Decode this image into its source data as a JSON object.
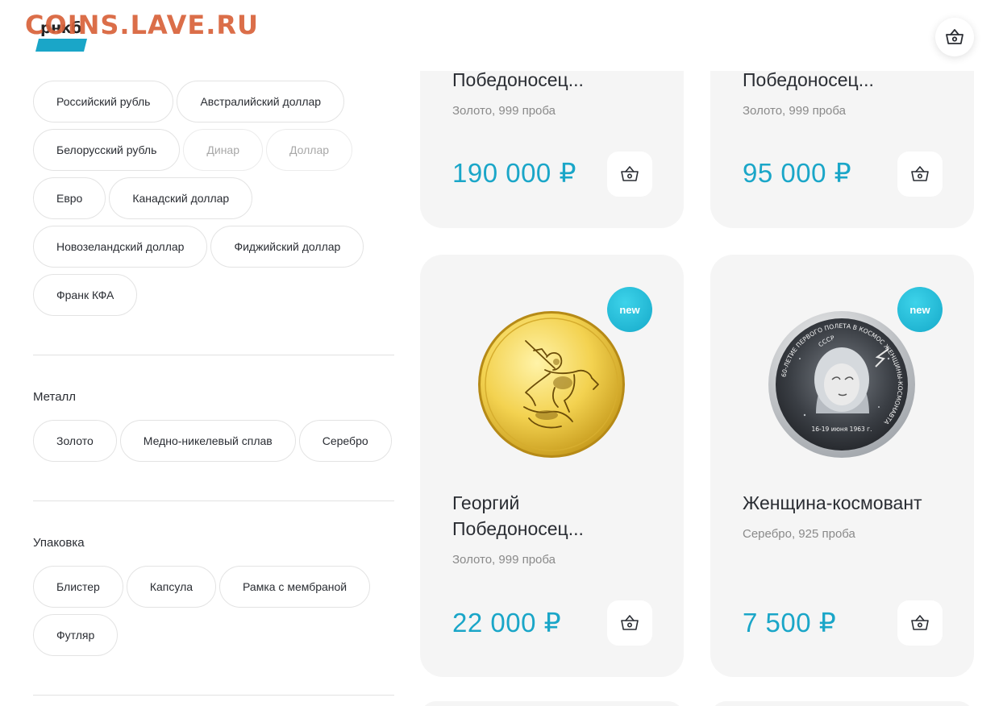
{
  "watermark": "COINS.LAVE.RU",
  "logo_text": "рнкб",
  "header": {
    "cart_icon": "basket-icon"
  },
  "filters": {
    "currencies": [
      {
        "label": "Российский рубль",
        "disabled": false
      },
      {
        "label": "Австралийский доллар",
        "disabled": false
      },
      {
        "label": "Белорусский рубль",
        "disabled": false
      },
      {
        "label": "Динар",
        "disabled": true
      },
      {
        "label": "Доллар",
        "disabled": true
      },
      {
        "label": "Евро",
        "disabled": false
      },
      {
        "label": "Канадский доллар",
        "disabled": false
      },
      {
        "label": "Новозеландский доллар",
        "disabled": false
      },
      {
        "label": "Фиджийский доллар",
        "disabled": false
      },
      {
        "label": "Франк КФА",
        "disabled": false
      }
    ],
    "metal": {
      "title": "Металл",
      "options": [
        "Золото",
        "Медно-никелевый сплав",
        "Серебро"
      ]
    },
    "packaging": {
      "title": "Упаковка",
      "options": [
        "Блистер",
        "Капсула",
        "Рамка с мембраной",
        "Футляр"
      ]
    }
  },
  "products": [
    {
      "title_line2": "Победоносец...",
      "meta": "Золото, 999 проба",
      "price": "190 000 ₽"
    },
    {
      "title_line2": "Победоносец...",
      "meta": "Золото, 999 проба",
      "price": "95 000 ₽"
    },
    {
      "badge": "new",
      "title_line1": "Георгий",
      "title_line2": "Победоносец...",
      "meta": "Золото, 999 проба",
      "price": "22 000 ₽",
      "image": "gold-coin-george"
    },
    {
      "badge": "new",
      "title_line1": "Женщина-космовант",
      "meta": "Серебро, 925 проба",
      "price": "7 500 ₽",
      "image": "silver-coin-cosmonaut",
      "coin_text": {
        "top": "СССР",
        "ring": "60-ЛЕТИЕ ПЕРВОГО ПОЛЕТА В КОСМОС ЖЕНЩИНЫ-КОСМОНАВТА",
        "date": "16-19 июня 1963 г."
      }
    }
  ],
  "colors": {
    "accent": "#1aa6c8",
    "card_bg": "#f5f5f5",
    "watermark": "#d9623a"
  }
}
